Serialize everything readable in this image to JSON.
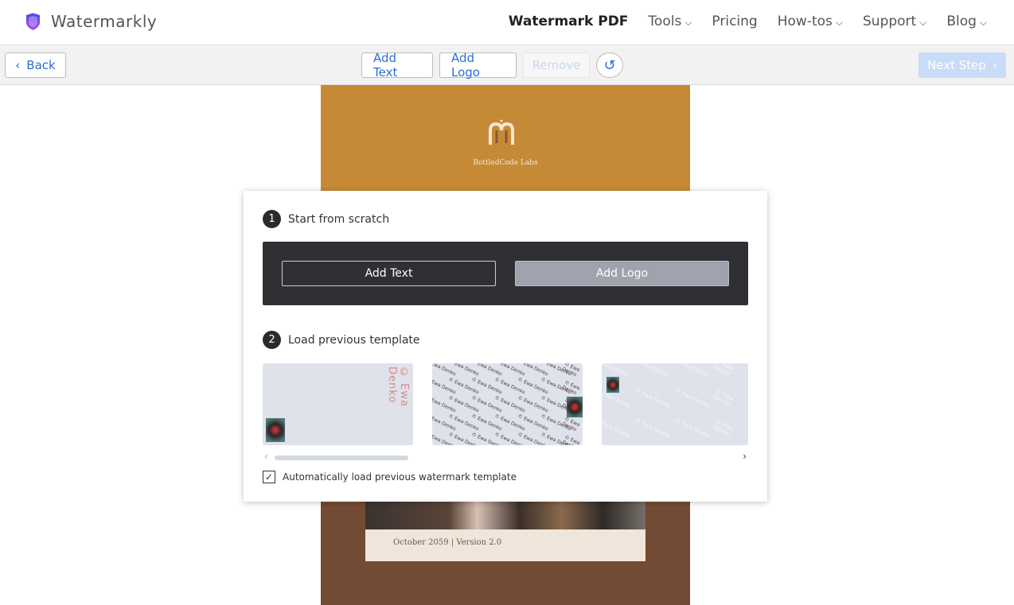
{
  "header": {
    "brand": "Watermarkly",
    "brand_color": "#6a4df5",
    "nav": [
      {
        "label": "Watermark PDF",
        "active": true
      },
      {
        "label": "Tools",
        "dropdown": true
      },
      {
        "label": "Pricing"
      },
      {
        "label": "How-tos",
        "dropdown": true
      },
      {
        "label": "Support",
        "dropdown": true
      },
      {
        "label": "Blog",
        "dropdown": true
      }
    ]
  },
  "toolbar": {
    "back": "Back",
    "add_text": "Add Text",
    "add_logo": "Add Logo",
    "remove": "Remove",
    "undo_icon": "rotate-icon",
    "next": "Next Step"
  },
  "document": {
    "brand": "BottledCode Labs",
    "footer": "October 2059 | Version 2.0"
  },
  "modal": {
    "step1": {
      "num": "1",
      "label": "Start from scratch",
      "add_text": "Add Text",
      "add_logo": "Add Logo"
    },
    "step2": {
      "num": "2",
      "label": "Load previous template",
      "templates": [
        {
          "text": "© Ewa Denko"
        },
        {
          "text": "© Ewa Denko"
        },
        {
          "text": "© Ewa Denko"
        }
      ]
    },
    "auto_load": {
      "label": "Automatically load previous watermark template",
      "checked": true
    }
  }
}
